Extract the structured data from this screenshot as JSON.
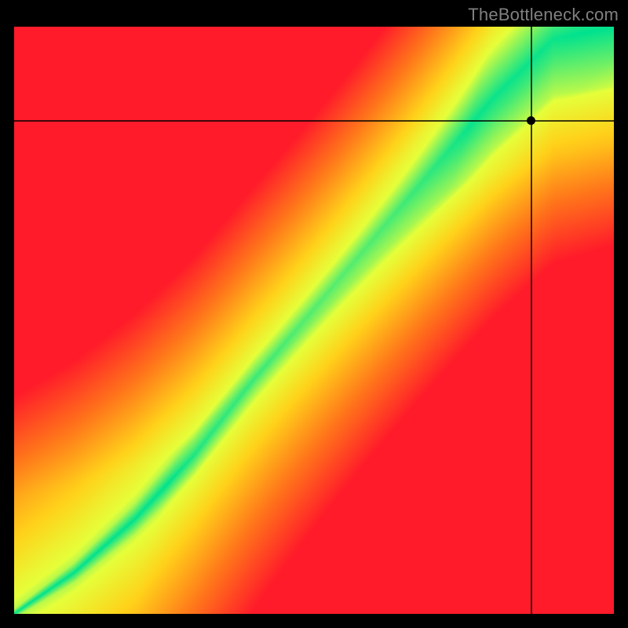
{
  "watermark": "TheBottleneck.com",
  "chart_data": {
    "type": "heatmap",
    "title": "",
    "xlabel": "",
    "ylabel": "",
    "xlim": [
      0,
      1
    ],
    "ylim": [
      0,
      1
    ],
    "crosshair": {
      "x": 0.863,
      "y": 0.84
    },
    "marker": {
      "x": 0.863,
      "y": 0.84
    },
    "colors": {
      "low": "#ff1b2a",
      "warm": "#ff7a1a",
      "mid": "#ffd21a",
      "high": "#e6ff3a",
      "peak": "#00e28f"
    },
    "ridge": {
      "description": "Optimal pairing ridge — green band where CPU and GPU balance",
      "points": [
        {
          "x": 0.0,
          "y": 0.0
        },
        {
          "x": 0.1,
          "y": 0.07
        },
        {
          "x": 0.2,
          "y": 0.16
        },
        {
          "x": 0.3,
          "y": 0.27
        },
        {
          "x": 0.4,
          "y": 0.4
        },
        {
          "x": 0.5,
          "y": 0.52
        },
        {
          "x": 0.6,
          "y": 0.64
        },
        {
          "x": 0.7,
          "y": 0.76
        },
        {
          "x": 0.8,
          "y": 0.88
        },
        {
          "x": 0.9,
          "y": 0.98
        },
        {
          "x": 1.0,
          "y": 1.0
        }
      ],
      "width_top": 0.2,
      "width_bottom": 0.015
    }
  }
}
